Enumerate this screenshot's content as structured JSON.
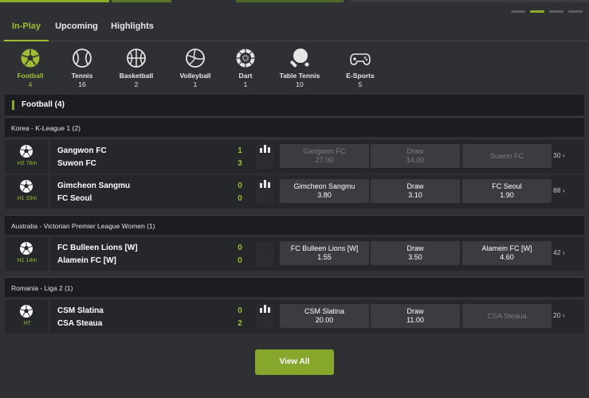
{
  "tabs": [
    {
      "label": "In-Play",
      "active": true
    },
    {
      "label": "Upcoming",
      "active": false
    },
    {
      "label": "Highlights",
      "active": false
    }
  ],
  "sports": [
    {
      "name": "Football",
      "count": "4",
      "icon": "football-icon",
      "active": true
    },
    {
      "name": "Tennis",
      "count": "16",
      "icon": "tennis-ball-icon"
    },
    {
      "name": "Basketball",
      "count": "2",
      "icon": "basketball-icon"
    },
    {
      "name": "Volleyball",
      "count": "1",
      "icon": "volleyball-icon"
    },
    {
      "name": "Dart",
      "count": "1",
      "icon": "dartboard-icon"
    },
    {
      "name": "Table Tennis",
      "count": "10",
      "icon": "table-tennis-icon"
    },
    {
      "name": "E-Sports",
      "count": "5",
      "icon": "gamepad-icon"
    }
  ],
  "section": {
    "title": "Football",
    "count": "(4)"
  },
  "leagues": [
    {
      "name": "Korea - K-League 1 (2)",
      "matches": [
        {
          "time": "H2 76m",
          "home": "Gangwon FC",
          "away": "Suwon FC",
          "home_score": "1",
          "away_score": "3",
          "odds": [
            {
              "label": "Gangwon FC",
              "value": "27.00"
            },
            {
              "label": "Draw",
              "value": "14.00"
            },
            {
              "label": "Suwon FC",
              "value": ""
            }
          ],
          "more": "30"
        },
        {
          "time": "H1 33m",
          "home": "Gimcheon Sangmu",
          "away": "FC Seoul",
          "home_score": "0",
          "away_score": "0",
          "odds": [
            {
              "label": "Gimcheon Sangmu",
              "value": "3.80"
            },
            {
              "label": "Draw",
              "value": "3.10"
            },
            {
              "label": "FC Seoul",
              "value": "1.90"
            }
          ],
          "more": "88"
        }
      ]
    },
    {
      "name": "Australia - Victorian Premier League Women (1)",
      "matches": [
        {
          "time": "H1 14m",
          "home": "FC Bulleen Lions [W]",
          "away": "Alamein FC [W]",
          "home_score": "0",
          "away_score": "0",
          "odds": [
            {
              "label": "FC Bulleen Lions [W]",
              "value": "1.55"
            },
            {
              "label": "Draw",
              "value": "3.50"
            },
            {
              "label": "Alamein FC [W]",
              "value": "4.60"
            }
          ],
          "more": "42"
        }
      ]
    },
    {
      "name": "Romania - Liga 2 (1)",
      "matches": [
        {
          "time": "HT",
          "home": "CSM Slatina",
          "away": "CSA Steaua",
          "home_score": "0",
          "away_score": "2",
          "odds": [
            {
              "label": "CSM Slatina",
              "value": "20.00"
            },
            {
              "label": "Draw",
              "value": "11.00"
            },
            {
              "label": "CSA Steaua",
              "value": ""
            }
          ],
          "more": "20"
        }
      ]
    }
  ],
  "view_all_label": "View All",
  "colors": {
    "accent": "#9dbd34",
    "button": "#86a62c",
    "background": "#2e3034"
  }
}
